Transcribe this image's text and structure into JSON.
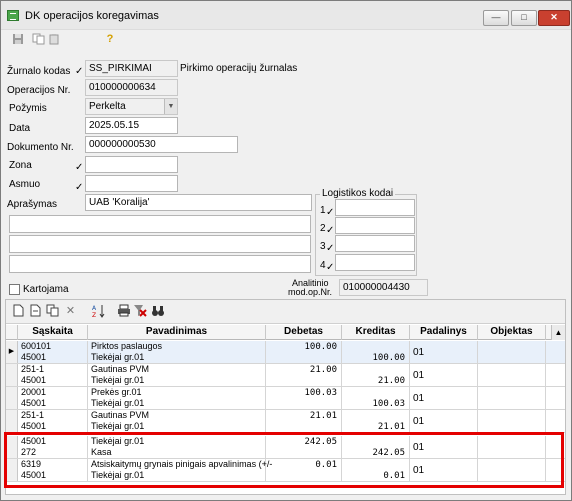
{
  "window": {
    "title": "DK operacijos koregavimas",
    "min_glyph": "—",
    "max_glyph": "□",
    "close_glyph": "✕"
  },
  "toolbar": {
    "save_icon": "save-icon",
    "copy_icon": "copy-icon",
    "help_icon": "help-icon"
  },
  "form": {
    "zurnalo_kodas_label": "Žurnalo kodas",
    "zurnalo_kodas": "SS_PIRKIMAI",
    "zurnalo_pavadinimas": "Pirkimo operacijų žurnalas",
    "operacijos_nr_label": "Operacijos Nr.",
    "operacijos_nr": "010000000634",
    "pozymis_label": "Požymis",
    "pozymis": "Perkelta",
    "data_label": "Data",
    "data": "2025.05.15",
    "dokumento_nr_label": "Dokumento Nr.",
    "dokumento_nr": "000000000530",
    "zona_label": "Zona",
    "zona": "",
    "asmuo_label": "Asmuo",
    "asmuo": "",
    "aprasymas_label": "Aprašymas",
    "aprasymas": "UAB 'Koralija'",
    "logistikos_title": "Logistikos kodai",
    "logistikos": [
      {
        "label": "1",
        "value": ""
      },
      {
        "label": "2",
        "value": ""
      },
      {
        "label": "3",
        "value": ""
      },
      {
        "label": "4",
        "value": ""
      }
    ],
    "kartojama_label": "Kartojama",
    "kartojama_checked": false,
    "analitinio_label_1": "Analitinio",
    "analitinio_label_2": "mod.op.Nr.",
    "analitinio_nr": "010000004430"
  },
  "grid": {
    "columns": [
      "Sąskaita",
      "Pavadinimas",
      "Debetas",
      "Kreditas",
      "Padalinys",
      "Objektas"
    ],
    "rows": [
      {
        "acc1": "600101",
        "acc2": "45001",
        "name1": "Pirktos paslaugos",
        "name2": "Tiekėjai gr.01",
        "debet": "100.00",
        "kredit": "100.00",
        "pad": "01",
        "obj": ""
      },
      {
        "acc1": "251-1",
        "acc2": "45001",
        "name1": "Gautinas PVM",
        "name2": "Tiekėjai gr.01",
        "debet": "21.00",
        "kredit": "21.00",
        "pad": "01",
        "obj": ""
      },
      {
        "acc1": "20001",
        "acc2": "45001",
        "name1": "Prekės gr.01",
        "name2": "Tiekėjai gr.01",
        "debet": "100.03",
        "kredit": "100.03",
        "pad": "01",
        "obj": ""
      },
      {
        "acc1": "251-1",
        "acc2": "45001",
        "name1": "Gautinas PVM",
        "name2": "Tiekėjai gr.01",
        "debet": "21.01",
        "kredit": "21.01",
        "pad": "01",
        "obj": ""
      },
      {
        "acc1": "45001",
        "acc2": "272",
        "name1": "Tiekėjai gr.01",
        "name2": "Kasa",
        "debet": "242.05",
        "kredit": "242.05",
        "pad": "01",
        "obj": ""
      },
      {
        "acc1": "6319",
        "acc2": "45001",
        "name1": "Atsiskaitymų grynais pinigais apvalinimas (+/-",
        "name2": "Tiekėjai gr.01",
        "debet": "0.01",
        "kredit": "0.01",
        "pad": "01",
        "obj": ""
      }
    ]
  },
  "colors": {
    "highlight": "#e40000",
    "close_button": "#c9402f",
    "selected_row": "#e8f0fa"
  }
}
